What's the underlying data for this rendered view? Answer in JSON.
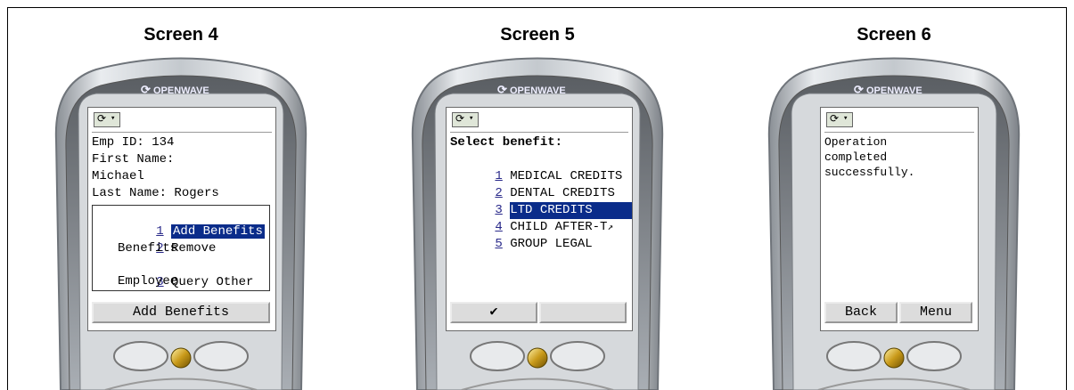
{
  "screens": [
    {
      "title": "Screen 4",
      "brand": "OPENWAVE",
      "lines": [
        "Emp ID: 134",
        "First Name:",
        "Michael",
        "Last Name: Rogers"
      ],
      "menu": [
        {
          "num": "1",
          "line1": "Add Benefits",
          "line2": "",
          "selected": true
        },
        {
          "num": "2",
          "line1": "Remove",
          "line2": "Benefits",
          "selected": false
        },
        {
          "num": "3",
          "line1": "Query Other",
          "line2": "Employee",
          "selected": false
        }
      ],
      "softkey": "Add Benefits"
    },
    {
      "title": "Screen 5",
      "brand": "OPENWAVE",
      "heading": "Select benefit:",
      "items": [
        {
          "num": "1",
          "label": "MEDICAL CREDITS",
          "selected": false
        },
        {
          "num": "2",
          "label": "DENTAL CREDITS",
          "selected": false
        },
        {
          "num": "3",
          "label": "LTD CREDITS",
          "selected": true
        },
        {
          "num": "4",
          "label": "CHILD AFTER-T",
          "selected": false
        },
        {
          "num": "5",
          "label": "GROUP LEGAL",
          "selected": false
        }
      ],
      "softkey_left": "✔",
      "softkey_right": ""
    },
    {
      "title": "Screen 6",
      "brand": "OPENWAVE",
      "lines": [
        "Operation",
        "completed",
        "successfully."
      ],
      "softkey_left": "Back",
      "softkey_right": "Menu"
    }
  ],
  "colors": {
    "highlight": "#0a2c8a",
    "link_number": "#2a2a8a",
    "phone_silver": "#c9cdd2"
  }
}
